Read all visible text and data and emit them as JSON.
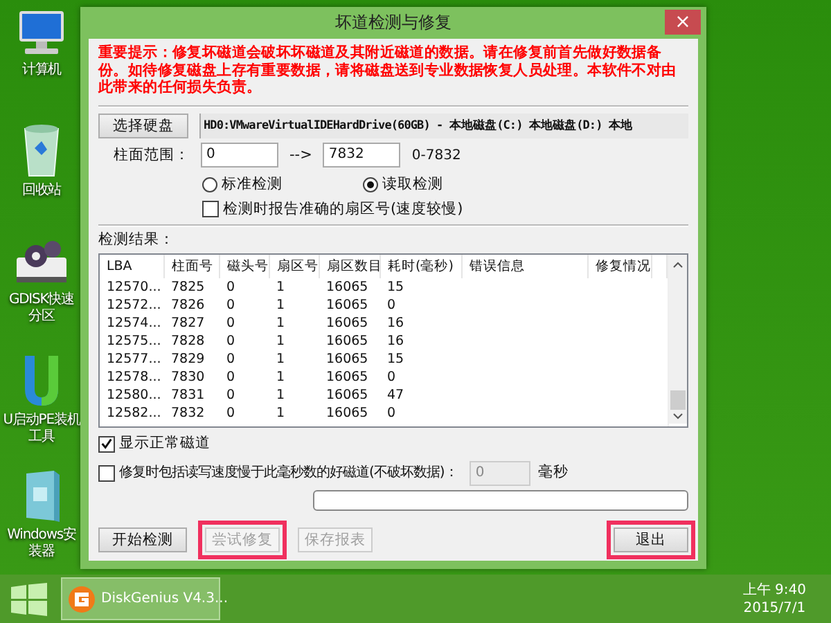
{
  "desktop_icons": [
    {
      "label": "计算机",
      "kind": "computer"
    },
    {
      "label": "回收站",
      "kind": "recycle"
    },
    {
      "label": "GDISK快速分区",
      "kind": "drive"
    },
    {
      "label": "U启动PE装机工具",
      "kind": "logo"
    },
    {
      "label": "Windows安装器",
      "kind": "box"
    }
  ],
  "window": {
    "title": "坏道检测与修复",
    "close": "×"
  },
  "warning": "重要提示：修复坏磁道会破坏坏磁道及其附近磁道的数据。请在修复前首先做好数据备份。如待修复磁盘上存有重要数据，请将磁盘送到专业数据恢复人员处理。本软件不对由此带来的任何损失负责。",
  "select_disk_button": "选择硬盘",
  "disk": "HD0:VMwareVirtualIDEHardDrive(60GB) - 本地磁盘(C:) 本地磁盘(D:) 本地",
  "cylinder": {
    "label": "柱面范围：",
    "from": "0",
    "arrow": "-->",
    "to": "7832",
    "range": "0-7832"
  },
  "modes": [
    {
      "label": "标准检测",
      "selected": false
    },
    {
      "label": "读取检测",
      "selected": true
    }
  ],
  "report_exact": {
    "label": "检测时报告准确的扇区号(速度较慢)",
    "checked": false
  },
  "results_label": "检测结果：",
  "table": {
    "columns": [
      "LBA",
      "柱面号",
      "磁头号",
      "扇区号",
      "扇区数目",
      "耗时(毫秒)",
      "错误信息",
      "修复情况"
    ],
    "rows": [
      [
        "12570...",
        "7825",
        "0",
        "1",
        "16065",
        "15"
      ],
      [
        "12572...",
        "7826",
        "0",
        "1",
        "16065",
        "0"
      ],
      [
        "12574...",
        "7827",
        "0",
        "1",
        "16065",
        "16"
      ],
      [
        "12575...",
        "7828",
        "0",
        "1",
        "16065",
        "16"
      ],
      [
        "12577...",
        "7829",
        "0",
        "1",
        "16065",
        "15"
      ],
      [
        "12578...",
        "7830",
        "0",
        "1",
        "16065",
        "0"
      ],
      [
        "12580...",
        "7831",
        "0",
        "1",
        "16065",
        "47"
      ],
      [
        "12582...",
        "7832",
        "0",
        "1",
        "16065",
        "0"
      ]
    ]
  },
  "show_normal": {
    "label": "显示正常磁道",
    "checked": true
  },
  "repair_slow": {
    "label": "修复时包括读写速度慢于此毫秒数的好磁道(不破坏数据)：",
    "checked": false,
    "value": "0",
    "unit": "毫秒"
  },
  "progress": {
    "level": 0
  },
  "buttons": [
    {
      "label": "开始检测",
      "disabled": false,
      "highlighted": false,
      "kind": "left"
    },
    {
      "label": "尝试修复",
      "disabled": true,
      "highlighted": true,
      "kind": "left"
    },
    {
      "label": "保存报表",
      "disabled": true,
      "highlighted": false,
      "kind": "left"
    },
    {
      "label": "退出",
      "disabled": false,
      "highlighted": true,
      "kind": "right"
    }
  ],
  "taskbar": {
    "task": "DiskGenius V4.3...",
    "time": "上午 9:40",
    "date": "2015/7/1"
  }
}
